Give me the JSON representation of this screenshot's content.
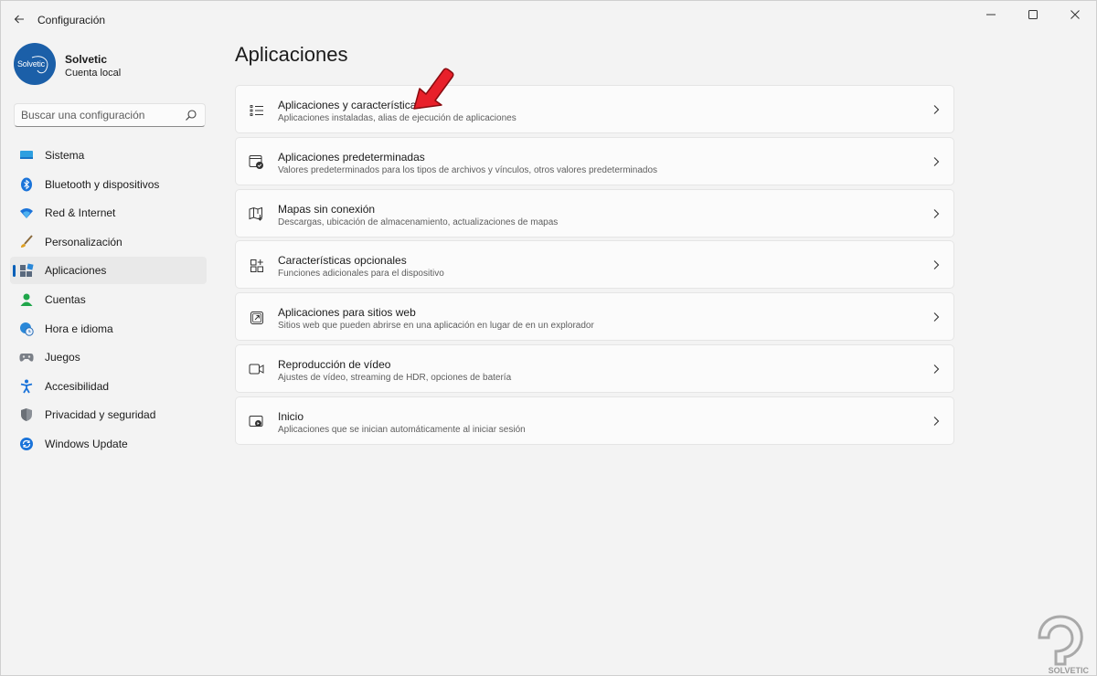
{
  "window": {
    "title": "Configuración"
  },
  "profile": {
    "name": "Solvetic",
    "account_type": "Cuenta local",
    "avatar_text": "Solvetic"
  },
  "search": {
    "placeholder": "Buscar una configuración"
  },
  "sidebar": {
    "items": [
      {
        "label": "Sistema",
        "icon": "monitor-icon",
        "active": false
      },
      {
        "label": "Bluetooth y dispositivos",
        "icon": "bluetooth-icon",
        "active": false
      },
      {
        "label": "Red & Internet",
        "icon": "wifi-icon",
        "active": false
      },
      {
        "label": "Personalización",
        "icon": "brush-icon",
        "active": false
      },
      {
        "label": "Aplicaciones",
        "icon": "apps-icon",
        "active": true
      },
      {
        "label": "Cuentas",
        "icon": "person-icon",
        "active": false
      },
      {
        "label": "Hora e idioma",
        "icon": "globe-clock-icon",
        "active": false
      },
      {
        "label": "Juegos",
        "icon": "gamepad-icon",
        "active": false
      },
      {
        "label": "Accesibilidad",
        "icon": "accessibility-icon",
        "active": false
      },
      {
        "label": "Privacidad y seguridad",
        "icon": "shield-icon",
        "active": false
      },
      {
        "label": "Windows Update",
        "icon": "refresh-icon",
        "active": false
      }
    ]
  },
  "main": {
    "title": "Aplicaciones",
    "cards": [
      {
        "title": "Aplicaciones y características",
        "description": "Aplicaciones instaladas, alias de ejecución de aplicaciones",
        "icon": "list-icon"
      },
      {
        "title": "Aplicaciones predeterminadas",
        "description": "Valores predeterminados para los tipos de archivos y vínculos, otros valores predeterminados",
        "icon": "default-app-icon"
      },
      {
        "title": "Mapas sin conexión",
        "description": "Descargas, ubicación de almacenamiento, actualizaciones de mapas",
        "icon": "map-icon"
      },
      {
        "title": "Características opcionales",
        "description": "Funciones adicionales para el dispositivo",
        "icon": "add-grid-icon"
      },
      {
        "title": "Aplicaciones para sitios web",
        "description": "Sitios web que pueden abrirse en una aplicación en lugar de en un explorador",
        "icon": "open-web-icon"
      },
      {
        "title": "Reproducción de vídeo",
        "description": "Ajustes de vídeo, streaming de HDR, opciones de batería",
        "icon": "video-icon"
      },
      {
        "title": "Inicio",
        "description": "Aplicaciones que se inician automáticamente al iniciar sesión",
        "icon": "startup-icon"
      }
    ]
  },
  "watermark": {
    "text": "SOLVETIC"
  },
  "colors": {
    "accent": "#005fb8",
    "annotation_arrow": "#e8202a",
    "avatar_bg": "#1b5fa8"
  }
}
